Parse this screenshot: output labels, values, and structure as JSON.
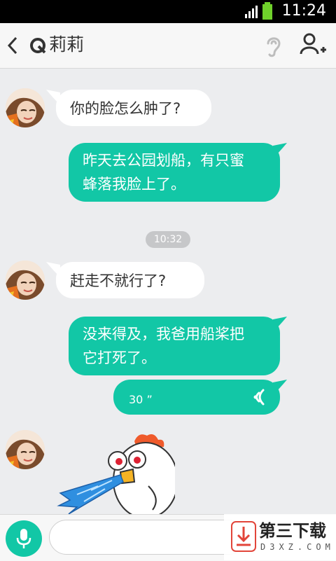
{
  "status_bar": {
    "time": "11:24"
  },
  "header": {
    "title": "莉莉"
  },
  "messages": [
    {
      "id": "m1",
      "side": "in",
      "text": "你的脸怎么肿了?"
    },
    {
      "id": "m2",
      "side": "out",
      "text_line1": "昨天去公园划船，有只蜜",
      "text_line2": "蜂落我脸上了。"
    },
    {
      "id": "m3",
      "side": "in",
      "text": "赶走不就行了?"
    },
    {
      "id": "m4",
      "side": "out",
      "text_line1": "没来得及，我爸用船桨把",
      "text_line2": "它打死了。"
    },
    {
      "id": "m5",
      "side": "out",
      "type": "voice",
      "duration": "30 ”"
    },
    {
      "id": "m6",
      "side": "in",
      "type": "sticker",
      "icon": "rooster-sticker"
    }
  ],
  "timestamp": "10:32",
  "input": {
    "placeholder": ""
  },
  "watermark": {
    "text": "第三下载",
    "sub": "D3XZ.COM"
  },
  "colors": {
    "accent": "#12c7a6",
    "background": "#ecedef",
    "bubble_in": "#ffffff"
  }
}
